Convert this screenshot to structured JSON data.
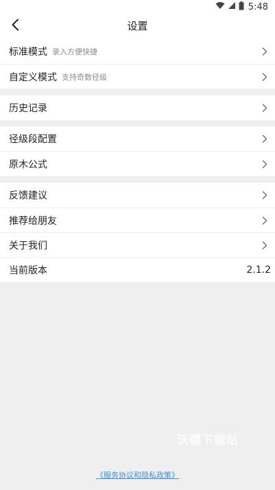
{
  "status_bar": {
    "time": "5:48",
    "icons": [
      "wifi-icon",
      "cell-signal-icon",
      "battery-icon"
    ]
  },
  "header": {
    "title": "设置",
    "back_icon": "chevron-left-icon"
  },
  "groups": [
    {
      "items": [
        {
          "label": "标准模式",
          "sub": "录入方便快捷"
        },
        {
          "label": "自定义模式",
          "sub": "支持奇数径级"
        }
      ]
    },
    {
      "items": [
        {
          "label": "历史记录"
        }
      ]
    },
    {
      "items": [
        {
          "label": "径级段配置"
        },
        {
          "label": "原木公式"
        }
      ]
    },
    {
      "items": [
        {
          "label": "反馈建议"
        },
        {
          "label": "推荐给朋友"
        },
        {
          "label": "关于我们"
        },
        {
          "label": "当前版本",
          "value": "2.1.2"
        }
      ]
    }
  ],
  "watermark": "沃德下载站",
  "footer": {
    "policy_link": "《服务协议和隐私政策》"
  },
  "colors": {
    "page_background": "#efefef",
    "card_background": "#ffffff",
    "link": "#3d8fd9"
  }
}
